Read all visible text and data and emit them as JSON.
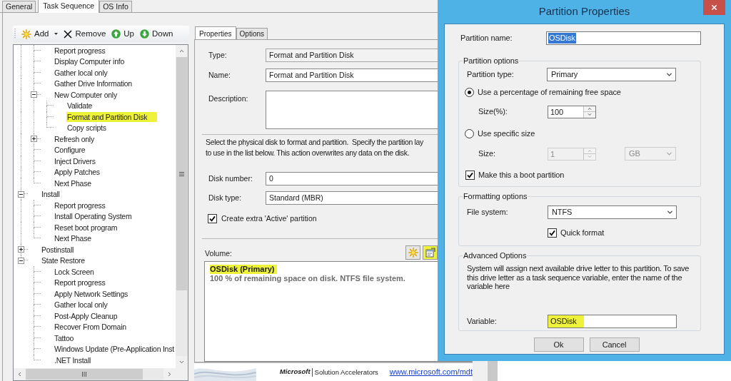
{
  "main_tabs": [
    {
      "label": "General",
      "selected": false
    },
    {
      "label": "Task Sequence",
      "selected": true
    },
    {
      "label": "OS Info",
      "selected": false
    }
  ],
  "toolbar": [
    {
      "kind": "add",
      "label": "Add",
      "menu": true
    },
    {
      "kind": "remove",
      "label": "Remove",
      "menu": false
    },
    {
      "kind": "up",
      "label": "Up",
      "menu": false
    },
    {
      "kind": "down",
      "label": "Down",
      "menu": false
    }
  ],
  "tree": {
    "items": [
      {
        "children": [
          {
            "label": "Report progress",
            "selected": false
          },
          {
            "label": "Display Computer info",
            "selected": false
          },
          {
            "label": "Gather local only",
            "selected": false
          },
          {
            "label": "Gather Drive Information",
            "selected": false
          },
          {
            "label": "New Computer only",
            "selected": false,
            "expanded": true,
            "children": [
              {
                "label": "Validate",
                "selected": false
              },
              {
                "label": "Format and Partition Disk",
                "selected": true
              },
              {
                "label": "Copy scripts",
                "selected": false
              }
            ]
          },
          {
            "label": "Refresh only",
            "selected": false,
            "expanded": false
          },
          {
            "label": "Configure",
            "selected": false
          },
          {
            "label": "Inject Drivers",
            "selected": false
          },
          {
            "label": "Apply Patches",
            "selected": false
          },
          {
            "label": "Next Phase",
            "selected": false
          }
        ]
      },
      {
        "label": "Install",
        "selected": false,
        "expanded": true,
        "children": [
          {
            "label": "Report progress",
            "selected": false
          },
          {
            "label": "Install Operating System",
            "selected": false
          },
          {
            "label": "Reset boot program",
            "selected": false
          },
          {
            "label": "Next Phase",
            "selected": false
          }
        ]
      },
      {
        "label": "Postinstall",
        "selected": false,
        "expanded": false
      },
      {
        "label": "State Restore",
        "selected": false,
        "expanded": true,
        "children": [
          {
            "label": "Lock Screen",
            "selected": false
          },
          {
            "label": "Report progress",
            "selected": false
          },
          {
            "label": "Apply Network Settings",
            "selected": false
          },
          {
            "label": "Gather local only",
            "selected": false
          },
          {
            "label": "Post-Apply Cleanup",
            "selected": false
          },
          {
            "label": "Recover From Domain",
            "selected": false
          },
          {
            "label": "Tattoo",
            "selected": false
          },
          {
            "label": "Windows Update (Pre-Application Inst",
            "selected": false
          },
          {
            "label": ".NET Install",
            "selected": false
          }
        ]
      }
    ]
  },
  "step_tabs": [
    {
      "label": "Properties",
      "selected": true
    },
    {
      "label": "Options",
      "selected": false
    }
  ],
  "step_fields": [
    {
      "kind": "readonly",
      "label": "Type:",
      "value": "Format and Partition Disk"
    },
    {
      "kind": "text",
      "label": "Name:",
      "value": "Format and Partition Disk"
    },
    {
      "kind": "textarea",
      "label": "Description:"
    }
  ],
  "instructions": "Select the physical disk to format and partition.  Specify the partition lay\nto use in the list below. This action overwrites any data on the disk.",
  "disk_fields": [
    {
      "label": "Disk number:",
      "value": "0"
    },
    {
      "label": "Disk type:",
      "value": "Standard (MBR)"
    }
  ],
  "active_partition": {
    "label": "Create extra 'Active' partition",
    "checked": true
  },
  "volume": {
    "label": "Volume:",
    "buttons": [
      {
        "kind": "new",
        "highlighted": false
      },
      {
        "kind": "properties",
        "highlighted": true
      }
    ],
    "items": [
      {
        "name": "OSDisk (Primary)",
        "detail": "100 % of remaining space on disk. NTFS file system.",
        "highlighted": true
      }
    ]
  },
  "footer": {
    "brand": "Microsoft",
    "product": "Solution Accelerators",
    "link": "www.microsoft.com/mdt"
  },
  "dialog": {
    "title": "Partition Properties",
    "partition_name": {
      "label": "Partition name:",
      "value": "OSDisk",
      "text_selected": true
    },
    "partition_options": {
      "title": "Partition options",
      "type": {
        "label": "Partition type:",
        "value": "Primary"
      },
      "size_modes": [
        {
          "label": "Use a percentage of remaining free space",
          "selected": true,
          "size_label": "Size(%):",
          "size": "100",
          "disabled": false
        },
        {
          "label": "Use specific size",
          "selected": false,
          "size_label": "Size:",
          "size": "1",
          "unit": "GB",
          "disabled": true
        }
      ],
      "boot": {
        "label": "Make this a boot partition",
        "checked": true
      }
    },
    "formatting_options": {
      "title": "Formatting options",
      "file_system": {
        "label": "File system:",
        "value": "NTFS"
      },
      "quick_format": {
        "label": "Quick format",
        "checked": true
      }
    },
    "advanced_options": {
      "title": "Advanced Options",
      "text": "System will assign next available drive letter to this partition. To save this drive letter as a task sequence variable, enter the name of the variable here",
      "variable": {
        "label": "Variable:",
        "value": "OSDisk",
        "highlighted": true
      }
    },
    "buttons": [
      "Ok",
      "Cancel"
    ]
  }
}
